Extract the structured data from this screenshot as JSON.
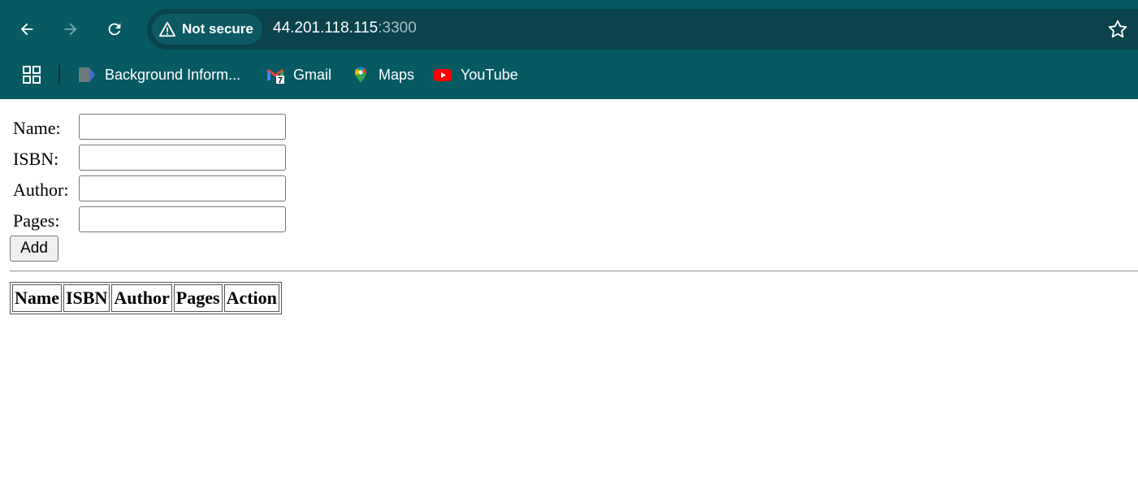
{
  "browser": {
    "security_label": "Not secure",
    "url_host": "44.201.118.115",
    "url_port": ":3300",
    "bookmarks": [
      {
        "label": "Background Inform...",
        "icon": "document-icon"
      },
      {
        "label": "Gmail",
        "icon": "gmail-icon",
        "badge": "7"
      },
      {
        "label": "Maps",
        "icon": "maps-icon"
      },
      {
        "label": "YouTube",
        "icon": "youtube-icon"
      }
    ],
    "colors": {
      "toolbar": "#075a62",
      "omnibox": "#0a434b"
    }
  },
  "form": {
    "fields": [
      {
        "label": "Name:",
        "value": "",
        "placeholder": ""
      },
      {
        "label": "ISBN:",
        "value": "",
        "placeholder": ""
      },
      {
        "label": "Author:",
        "value": "",
        "placeholder": ""
      },
      {
        "label": "Pages:",
        "value": "",
        "placeholder": ""
      }
    ],
    "add_label": "Add"
  },
  "table": {
    "headers": [
      "Name",
      "ISBN",
      "Author",
      "Pages",
      "Action"
    ],
    "rows": []
  }
}
